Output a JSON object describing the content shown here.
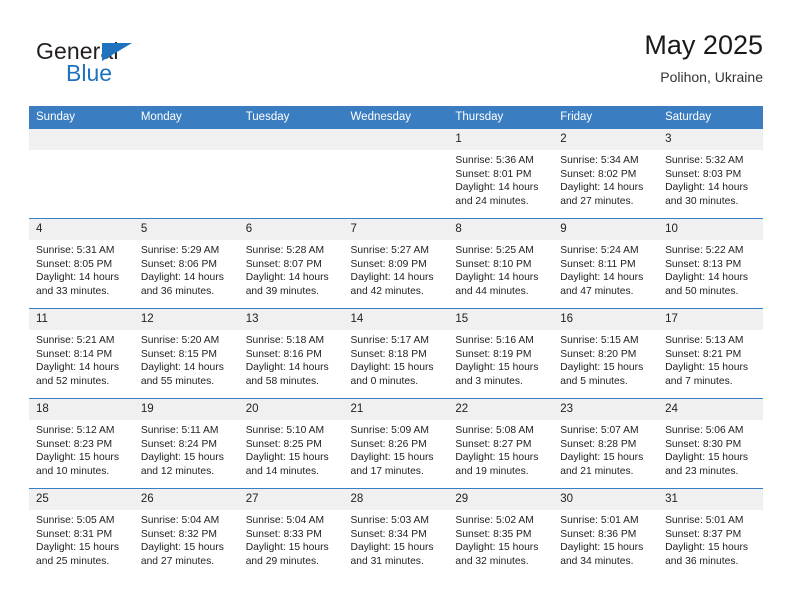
{
  "brand": {
    "name_top": "General",
    "name_bottom": "Blue",
    "triangle_color": "#1f72bd",
    "text_color": "#231f20"
  },
  "header": {
    "title": "May 2025",
    "subtitle": "Polihon, Ukraine"
  },
  "theme": {
    "header_blue": "#3a7dc0",
    "daynum_bg": "#f0f0f0",
    "page_bg": "#ffffff",
    "text": "#222222"
  },
  "calendar": {
    "weekday_headers": [
      "Sunday",
      "Monday",
      "Tuesday",
      "Wednesday",
      "Thursday",
      "Friday",
      "Saturday"
    ],
    "labels": {
      "sunrise": "Sunrise:",
      "sunset": "Sunset:",
      "daylight": "Daylight:"
    },
    "weeks": [
      [
        {
          "day": "",
          "empty": true
        },
        {
          "day": "",
          "empty": true
        },
        {
          "day": "",
          "empty": true
        },
        {
          "day": "",
          "empty": true
        },
        {
          "day": "1",
          "sunrise": "Sunrise: 5:36 AM",
          "sunset": "Sunset: 8:01 PM",
          "daylight": "Daylight: 14 hours and 24 minutes."
        },
        {
          "day": "2",
          "sunrise": "Sunrise: 5:34 AM",
          "sunset": "Sunset: 8:02 PM",
          "daylight": "Daylight: 14 hours and 27 minutes."
        },
        {
          "day": "3",
          "sunrise": "Sunrise: 5:32 AM",
          "sunset": "Sunset: 8:03 PM",
          "daylight": "Daylight: 14 hours and 30 minutes."
        }
      ],
      [
        {
          "day": "4",
          "sunrise": "Sunrise: 5:31 AM",
          "sunset": "Sunset: 8:05 PM",
          "daylight": "Daylight: 14 hours and 33 minutes."
        },
        {
          "day": "5",
          "sunrise": "Sunrise: 5:29 AM",
          "sunset": "Sunset: 8:06 PM",
          "daylight": "Daylight: 14 hours and 36 minutes."
        },
        {
          "day": "6",
          "sunrise": "Sunrise: 5:28 AM",
          "sunset": "Sunset: 8:07 PM",
          "daylight": "Daylight: 14 hours and 39 minutes."
        },
        {
          "day": "7",
          "sunrise": "Sunrise: 5:27 AM",
          "sunset": "Sunset: 8:09 PM",
          "daylight": "Daylight: 14 hours and 42 minutes."
        },
        {
          "day": "8",
          "sunrise": "Sunrise: 5:25 AM",
          "sunset": "Sunset: 8:10 PM",
          "daylight": "Daylight: 14 hours and 44 minutes."
        },
        {
          "day": "9",
          "sunrise": "Sunrise: 5:24 AM",
          "sunset": "Sunset: 8:11 PM",
          "daylight": "Daylight: 14 hours and 47 minutes."
        },
        {
          "day": "10",
          "sunrise": "Sunrise: 5:22 AM",
          "sunset": "Sunset: 8:13 PM",
          "daylight": "Daylight: 14 hours and 50 minutes."
        }
      ],
      [
        {
          "day": "11",
          "sunrise": "Sunrise: 5:21 AM",
          "sunset": "Sunset: 8:14 PM",
          "daylight": "Daylight: 14 hours and 52 minutes."
        },
        {
          "day": "12",
          "sunrise": "Sunrise: 5:20 AM",
          "sunset": "Sunset: 8:15 PM",
          "daylight": "Daylight: 14 hours and 55 minutes."
        },
        {
          "day": "13",
          "sunrise": "Sunrise: 5:18 AM",
          "sunset": "Sunset: 8:16 PM",
          "daylight": "Daylight: 14 hours and 58 minutes."
        },
        {
          "day": "14",
          "sunrise": "Sunrise: 5:17 AM",
          "sunset": "Sunset: 8:18 PM",
          "daylight": "Daylight: 15 hours and 0 minutes."
        },
        {
          "day": "15",
          "sunrise": "Sunrise: 5:16 AM",
          "sunset": "Sunset: 8:19 PM",
          "daylight": "Daylight: 15 hours and 3 minutes."
        },
        {
          "day": "16",
          "sunrise": "Sunrise: 5:15 AM",
          "sunset": "Sunset: 8:20 PM",
          "daylight": "Daylight: 15 hours and 5 minutes."
        },
        {
          "day": "17",
          "sunrise": "Sunrise: 5:13 AM",
          "sunset": "Sunset: 8:21 PM",
          "daylight": "Daylight: 15 hours and 7 minutes."
        }
      ],
      [
        {
          "day": "18",
          "sunrise": "Sunrise: 5:12 AM",
          "sunset": "Sunset: 8:23 PM",
          "daylight": "Daylight: 15 hours and 10 minutes."
        },
        {
          "day": "19",
          "sunrise": "Sunrise: 5:11 AM",
          "sunset": "Sunset: 8:24 PM",
          "daylight": "Daylight: 15 hours and 12 minutes."
        },
        {
          "day": "20",
          "sunrise": "Sunrise: 5:10 AM",
          "sunset": "Sunset: 8:25 PM",
          "daylight": "Daylight: 15 hours and 14 minutes."
        },
        {
          "day": "21",
          "sunrise": "Sunrise: 5:09 AM",
          "sunset": "Sunset: 8:26 PM",
          "daylight": "Daylight: 15 hours and 17 minutes."
        },
        {
          "day": "22",
          "sunrise": "Sunrise: 5:08 AM",
          "sunset": "Sunset: 8:27 PM",
          "daylight": "Daylight: 15 hours and 19 minutes."
        },
        {
          "day": "23",
          "sunrise": "Sunrise: 5:07 AM",
          "sunset": "Sunset: 8:28 PM",
          "daylight": "Daylight: 15 hours and 21 minutes."
        },
        {
          "day": "24",
          "sunrise": "Sunrise: 5:06 AM",
          "sunset": "Sunset: 8:30 PM",
          "daylight": "Daylight: 15 hours and 23 minutes."
        }
      ],
      [
        {
          "day": "25",
          "sunrise": "Sunrise: 5:05 AM",
          "sunset": "Sunset: 8:31 PM",
          "daylight": "Daylight: 15 hours and 25 minutes."
        },
        {
          "day": "26",
          "sunrise": "Sunrise: 5:04 AM",
          "sunset": "Sunset: 8:32 PM",
          "daylight": "Daylight: 15 hours and 27 minutes."
        },
        {
          "day": "27",
          "sunrise": "Sunrise: 5:04 AM",
          "sunset": "Sunset: 8:33 PM",
          "daylight": "Daylight: 15 hours and 29 minutes."
        },
        {
          "day": "28",
          "sunrise": "Sunrise: 5:03 AM",
          "sunset": "Sunset: 8:34 PM",
          "daylight": "Daylight: 15 hours and 31 minutes."
        },
        {
          "day": "29",
          "sunrise": "Sunrise: 5:02 AM",
          "sunset": "Sunset: 8:35 PM",
          "daylight": "Daylight: 15 hours and 32 minutes."
        },
        {
          "day": "30",
          "sunrise": "Sunrise: 5:01 AM",
          "sunset": "Sunset: 8:36 PM",
          "daylight": "Daylight: 15 hours and 34 minutes."
        },
        {
          "day": "31",
          "sunrise": "Sunrise: 5:01 AM",
          "sunset": "Sunset: 8:37 PM",
          "daylight": "Daylight: 15 hours and 36 minutes."
        }
      ]
    ]
  }
}
